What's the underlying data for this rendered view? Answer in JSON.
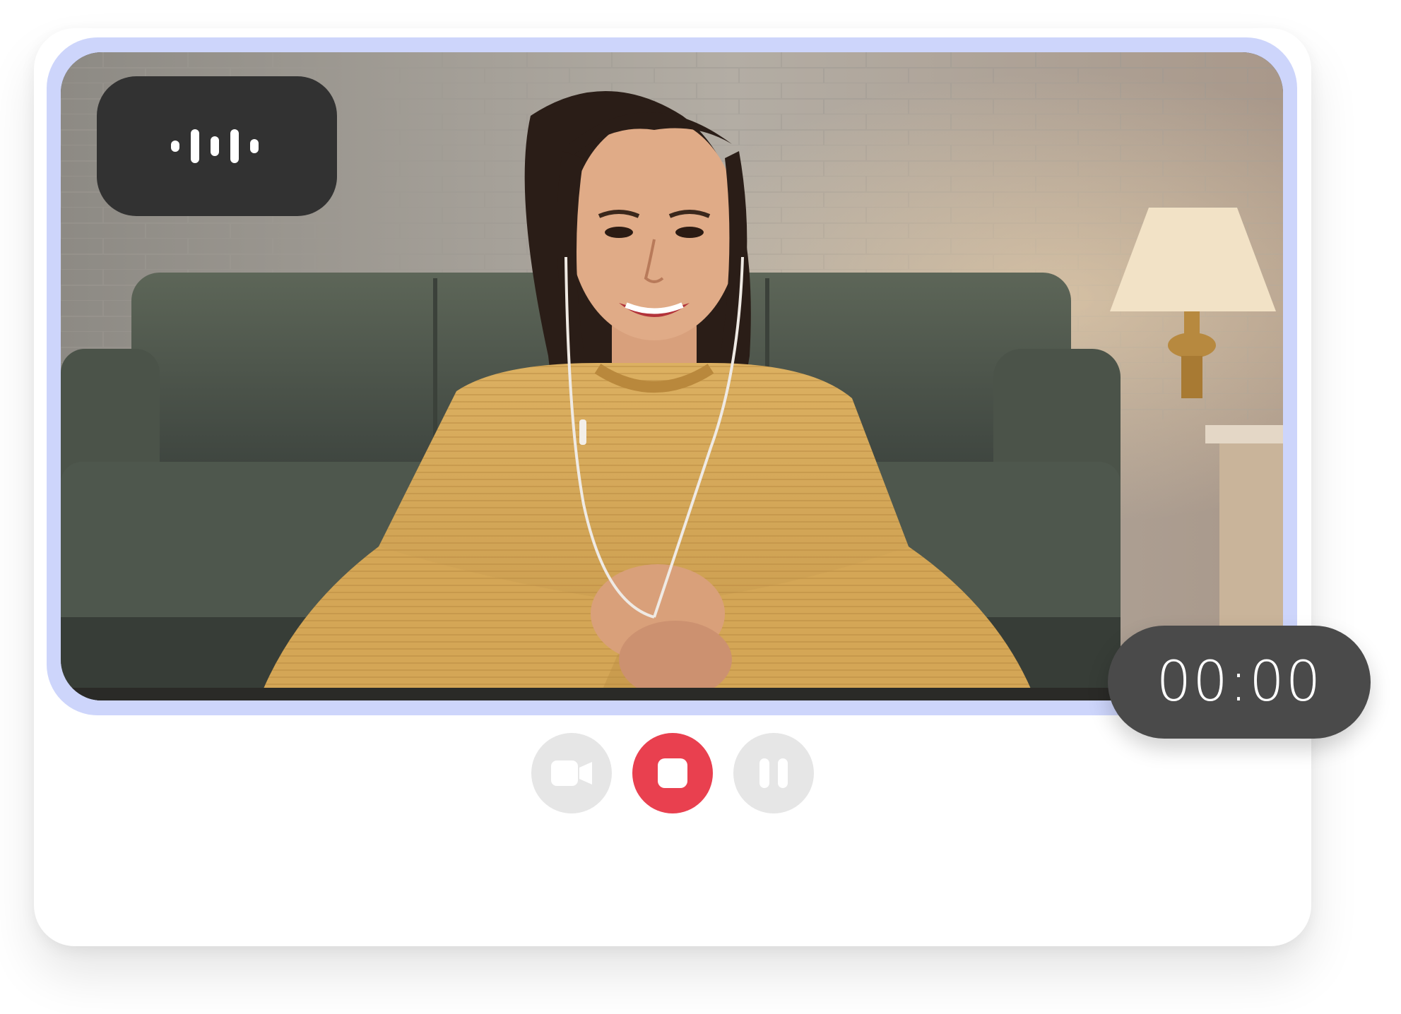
{
  "recorder": {
    "timer": "00:00",
    "controls": {
      "camera_icon": "video-camera-icon",
      "stop_icon": "stop-icon",
      "pause_icon": "pause-icon"
    },
    "mic_indicator_icon": "audio-waveform-icon",
    "colors": {
      "frame_accent": "#cdd5fb",
      "stop_button": "#e9404f",
      "secondary_button": "#e6e6e6",
      "chip_background": "#323232",
      "timer_background": "#4a4a4a"
    }
  }
}
